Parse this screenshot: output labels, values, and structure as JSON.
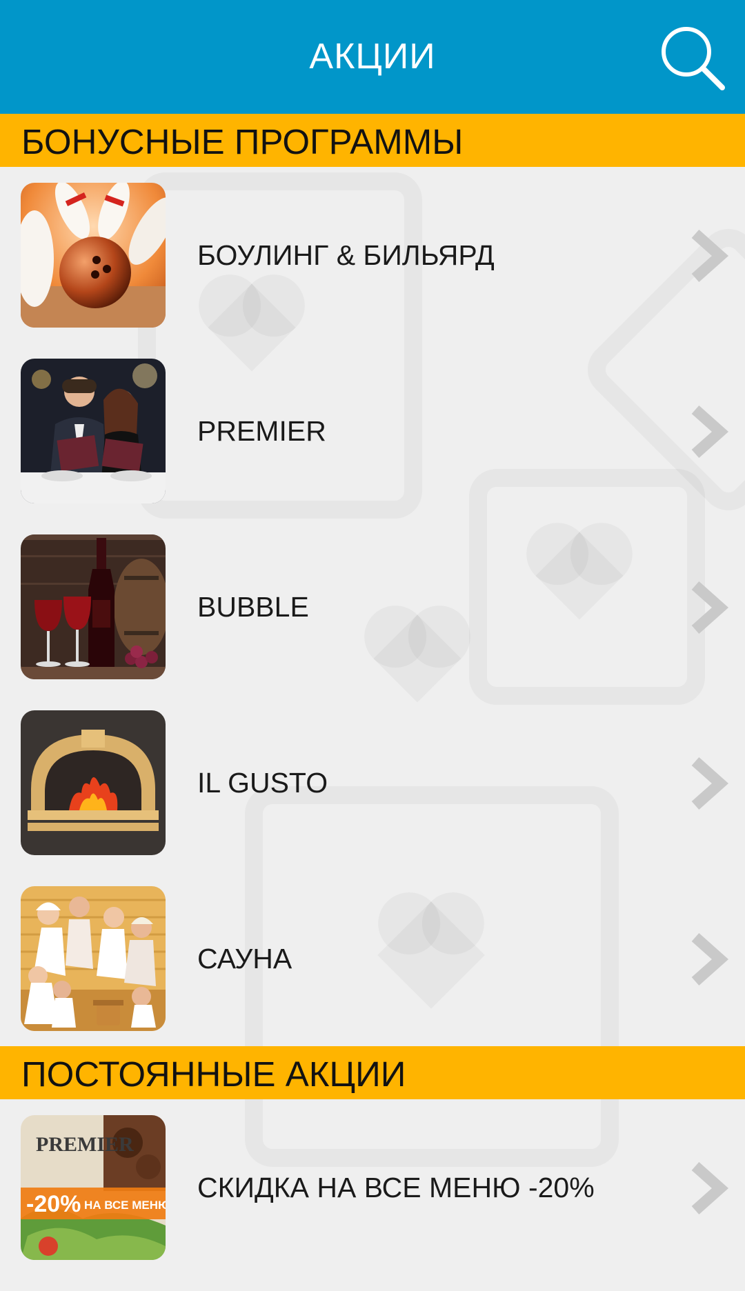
{
  "header": {
    "title": "АКЦИИ",
    "search_icon": "search-icon",
    "background": "#0196c9"
  },
  "sections": [
    {
      "title": "БОНУСНЫЕ ПРОГРАММЫ",
      "items": [
        {
          "label": "БОУЛИНГ & БИЛЬЯРД",
          "image": "bowling-image"
        },
        {
          "label": "PREMIER",
          "image": "restaurant-couple-image"
        },
        {
          "label": "BUBBLE",
          "image": "wine-bottle-image"
        },
        {
          "label": "IL GUSTO",
          "image": "pizza-oven-image"
        },
        {
          "label": "САУНА",
          "image": "sauna-image"
        }
      ]
    },
    {
      "title": "ПОСТОЯННЫЕ АКЦИИ",
      "items": [
        {
          "label": "СКИДКА НА ВСЕ МЕНЮ -20%",
          "image": "premier-discount-banner"
        }
      ]
    }
  ],
  "promo_banner": {
    "brand": "PREMIER",
    "discount": "-20%",
    "text": "НА ВСЕ МЕНЮ"
  },
  "colors": {
    "section_header": "#ffb400",
    "text": "#1a1a1a",
    "chevron": "#c9c9c9"
  },
  "chevron_icon": "chevron-right-icon"
}
